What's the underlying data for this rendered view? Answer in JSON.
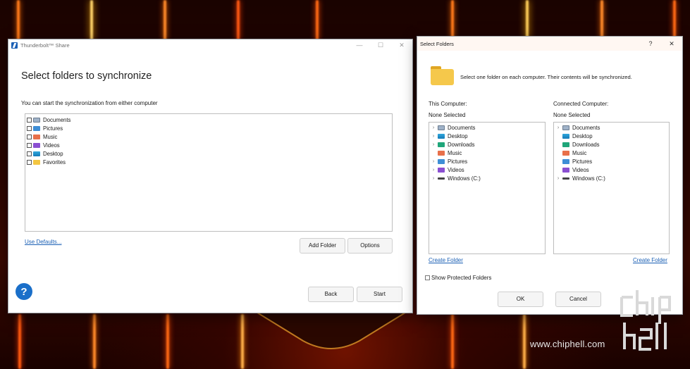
{
  "watermark": {
    "site": "www.chiphell.com",
    "logo_text": "chip hell"
  },
  "main_window": {
    "title": "Thunderbolt™ Share",
    "heading": "Select folders to synchronize",
    "subtext": "You can start the synchronization from either computer",
    "folders": [
      {
        "label": "Documents",
        "icon": "documents-icon"
      },
      {
        "label": "Pictures",
        "icon": "pictures-icon"
      },
      {
        "label": "Music",
        "icon": "music-icon"
      },
      {
        "label": "Videos",
        "icon": "videos-icon"
      },
      {
        "label": "Desktop",
        "icon": "desktop-icon"
      },
      {
        "label": "Favorites",
        "icon": "favorites-icon"
      }
    ],
    "use_defaults": "Use Defaults...",
    "add_folder": "Add Folder",
    "options": "Options",
    "back": "Back",
    "start": "Start",
    "help": "?"
  },
  "dialog": {
    "title": "Select Folders",
    "help_btn": "?",
    "close_btn": "✕",
    "instruction": "Select one folder on each computer.  Their contents will be synchronized.",
    "this_computer": {
      "label": "This Computer:",
      "selection": "None Selected",
      "tree": [
        {
          "label": "Documents",
          "expandable": true
        },
        {
          "label": "Desktop",
          "expandable": true
        },
        {
          "label": "Downloads",
          "expandable": true
        },
        {
          "label": "Music",
          "expandable": false
        },
        {
          "label": "Pictures",
          "expandable": true
        },
        {
          "label": "Videos",
          "expandable": true
        },
        {
          "label": "Windows (C:)",
          "expandable": true
        }
      ],
      "create_folder": "Create Folder"
    },
    "connected_computer": {
      "label": "Connected Computer:",
      "selection": "None Selected",
      "tree": [
        {
          "label": "Documents",
          "expandable": true
        },
        {
          "label": "Desktop",
          "expandable": false
        },
        {
          "label": "Downloads",
          "expandable": false
        },
        {
          "label": "Music",
          "expandable": false
        },
        {
          "label": "Pictures",
          "expandable": false
        },
        {
          "label": "Videos",
          "expandable": false
        },
        {
          "label": "Windows (C:)",
          "expandable": true
        }
      ],
      "create_folder": "Create Folder"
    },
    "show_protected": "Show Protected Folders",
    "ok": "OK",
    "cancel": "Cancel"
  }
}
